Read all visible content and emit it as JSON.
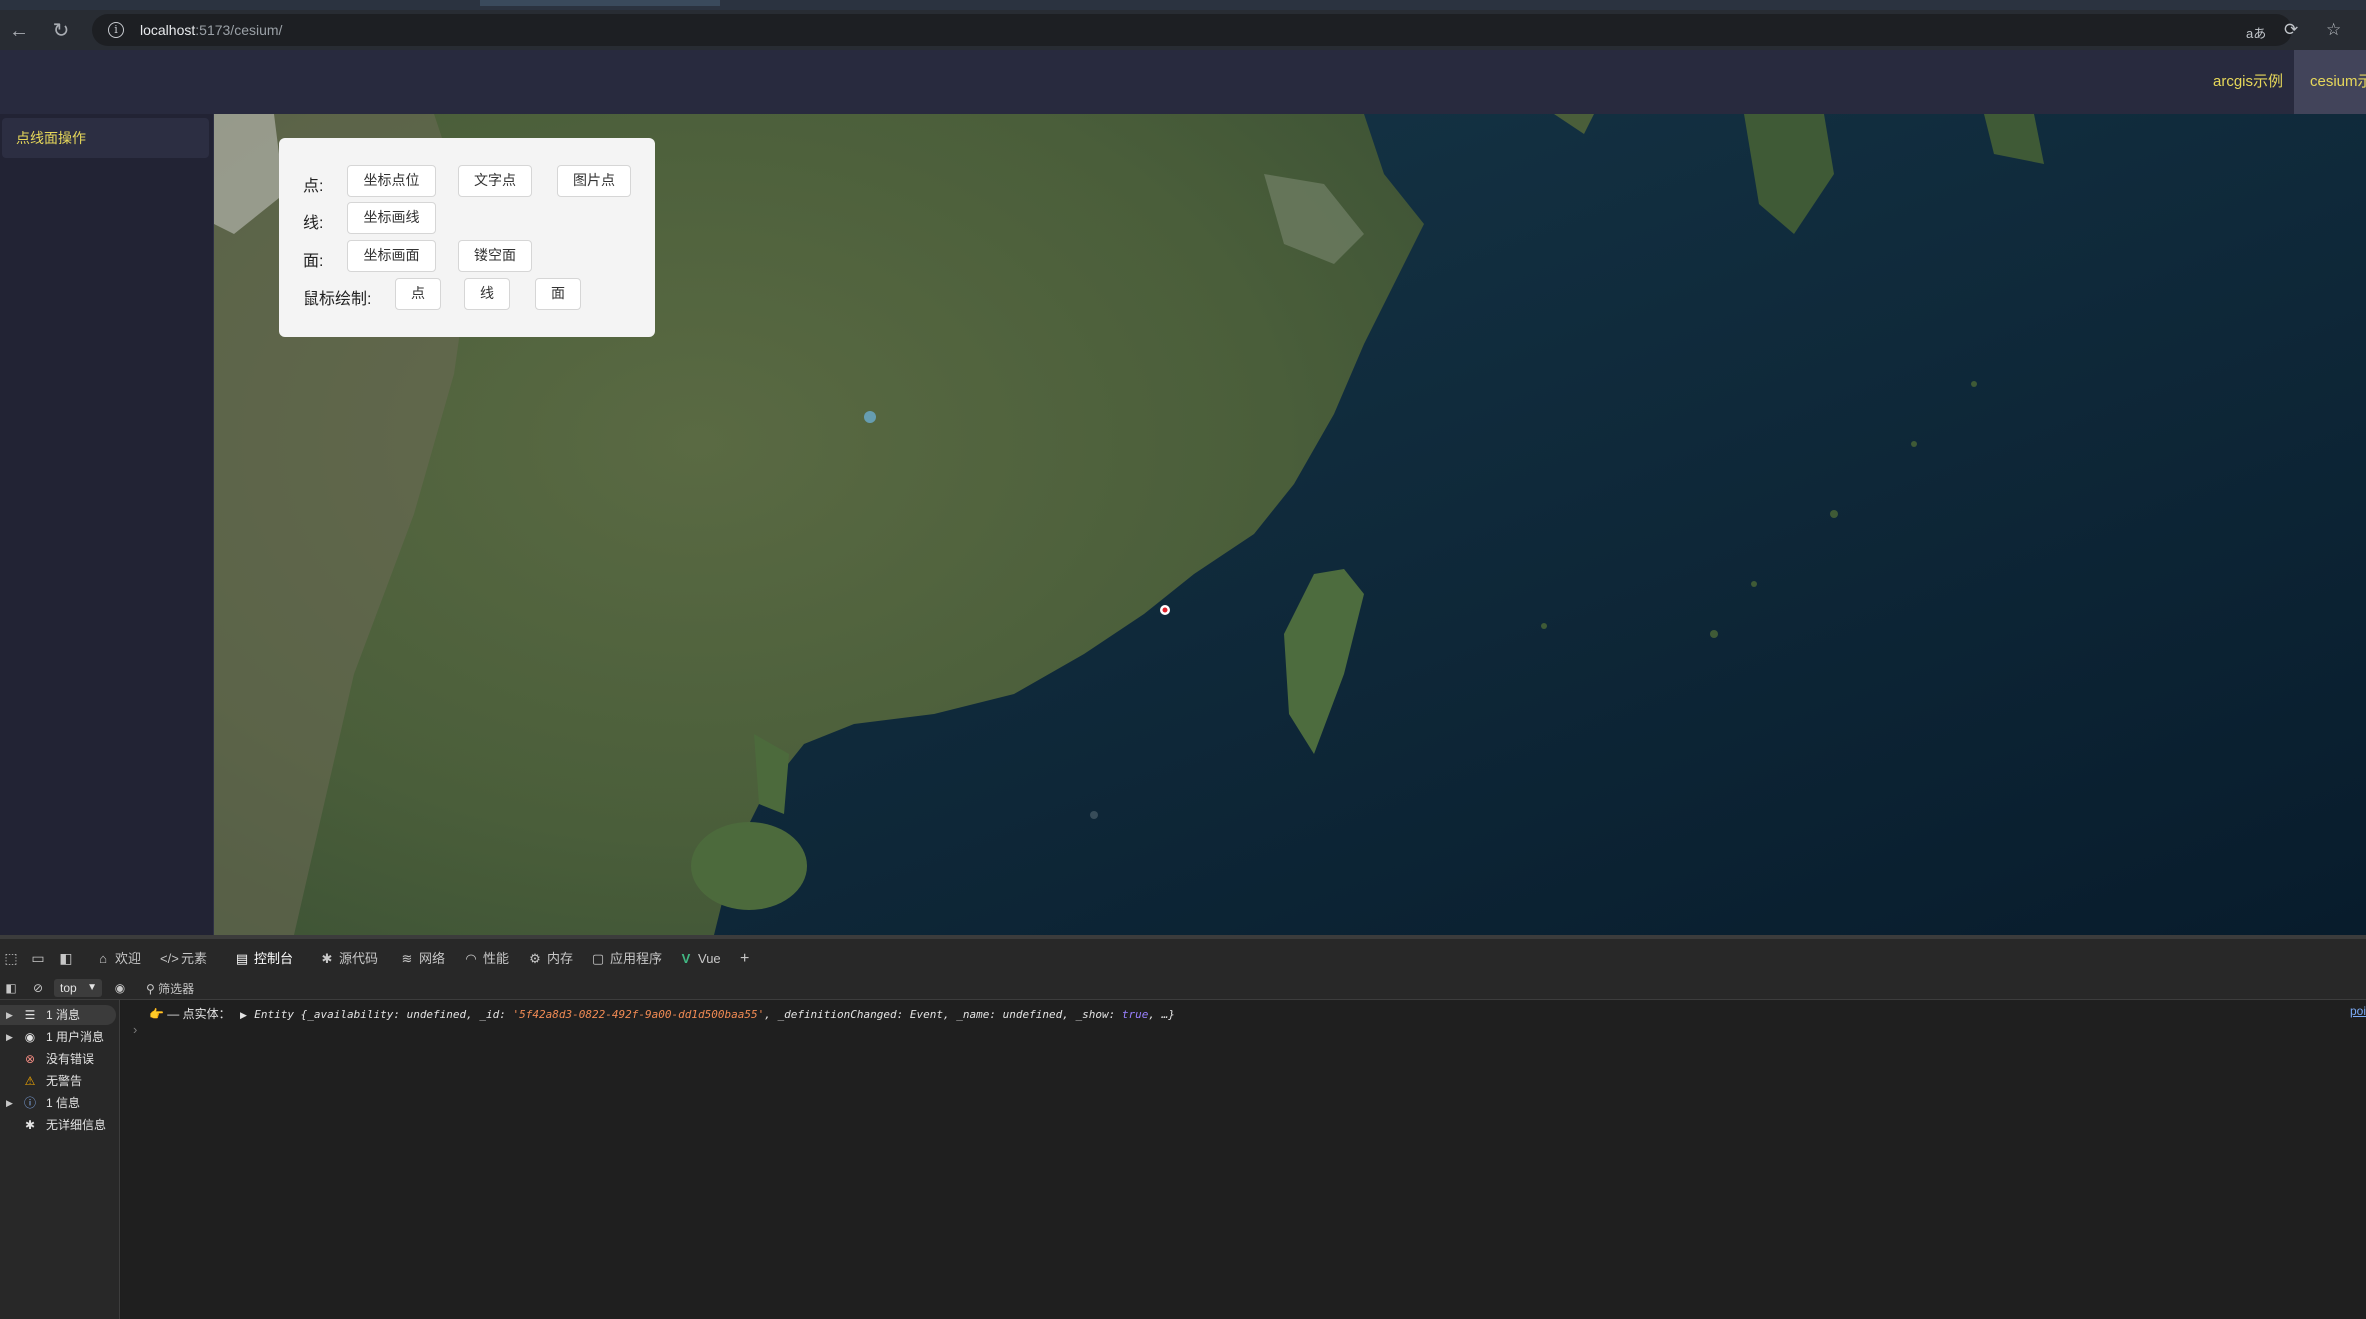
{
  "browser": {
    "url_host": "localhost",
    "url_path": ":5173/cesium/",
    "icons": [
      "back-arrow-icon",
      "reload-icon",
      "site-info-icon",
      "read-aloud-icon",
      "refresh-icon",
      "favorite-star-icon"
    ]
  },
  "header": {
    "nav": [
      {
        "label": "arcgis示例",
        "active": false
      },
      {
        "label": "cesium示例",
        "active": true
      }
    ]
  },
  "sidebar": {
    "items": [
      {
        "label": "点线面操作"
      }
    ]
  },
  "panel": {
    "rows": [
      {
        "label": "点:",
        "buttons": [
          "坐标点位",
          "文字点",
          "图片点"
        ]
      },
      {
        "label": "线:",
        "buttons": [
          "坐标画线"
        ]
      },
      {
        "label": "面:",
        "buttons": [
          "坐标画面",
          "镂空面"
        ]
      },
      {
        "label": "鼠标绘制:",
        "buttons": [
          "点",
          "线",
          "面"
        ]
      }
    ]
  },
  "devtools": {
    "tabs": [
      {
        "label": "欢迎",
        "icon": "home-icon"
      },
      {
        "label": "元素",
        "icon": "code-icon"
      },
      {
        "label": "控制台",
        "icon": "console-icon",
        "active": true
      },
      {
        "label": "源代码",
        "icon": "bug-icon"
      },
      {
        "label": "网络",
        "icon": "wifi-icon"
      },
      {
        "label": "性能",
        "icon": "performance-icon"
      },
      {
        "label": "内存",
        "icon": "memory-icon"
      },
      {
        "label": "应用程序",
        "icon": "application-icon"
      },
      {
        "label": "Vue",
        "icon": "vue-logo-icon"
      }
    ],
    "context": "top",
    "filter_label": "筛选器",
    "sidebar": [
      {
        "label": "1 消息",
        "icon": "list-icon",
        "expandable": true,
        "selected": true
      },
      {
        "label": "1 用户消息",
        "icon": "user-icon",
        "expandable": true
      },
      {
        "label": "没有错误",
        "icon": "error-icon",
        "color": "#f28b82"
      },
      {
        "label": "无警告",
        "icon": "warning-icon",
        "color": "#f9ab00"
      },
      {
        "label": "1 信息",
        "icon": "info-icon",
        "expandable": true,
        "color": "#8ab4f8"
      },
      {
        "label": "无详细信息",
        "icon": "bug-icon"
      }
    ],
    "log": {
      "prefix": "👉 — 点实体：",
      "entity": "Entity",
      "open": " {_availability: undefined, _id: ",
      "id": "'5f42a8d3-0822-492f-9a00-dd1d500baa55'",
      "mid": ", _definitionChanged: Event, _name: undefined, _show: ",
      "show": "true",
      "end": ", …}",
      "source": "poi"
    }
  },
  "colors": {
    "accent_yellow": "#e6d75a",
    "header_bg": "#282a3e",
    "sidebar_bg": "#222334",
    "devtools_active": "#7cacf8"
  }
}
